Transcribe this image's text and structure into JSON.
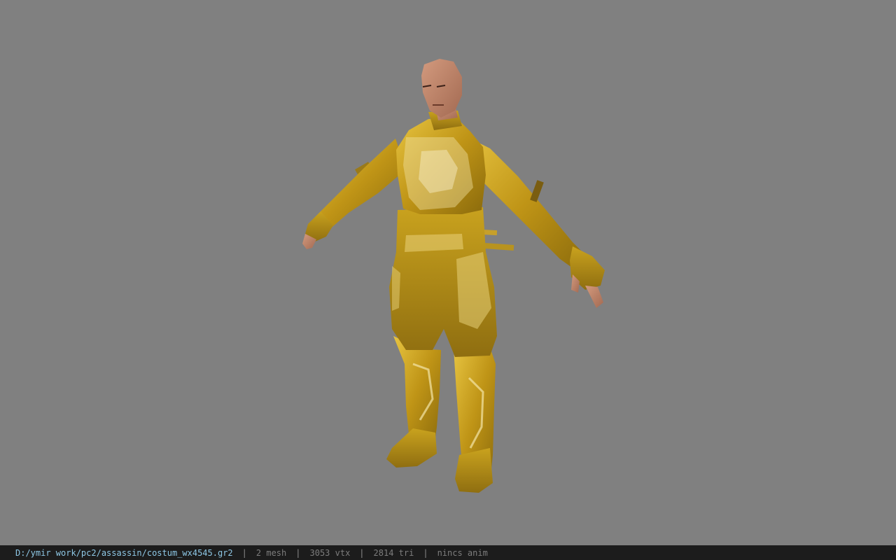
{
  "viewport": {
    "background_color": "#808080",
    "model": {
      "skin_color": "#c98a6d",
      "costume_color": "#c9a21e"
    }
  },
  "status_bar": {
    "file_path": "D:/ymir work/pc2/assassin/costum_wx4545.gr2",
    "separator": "|",
    "mesh_count": "2 mesh",
    "vertex_count": "3053 vtx",
    "triangle_count": "2814 tri",
    "animation": "nincs anim"
  }
}
